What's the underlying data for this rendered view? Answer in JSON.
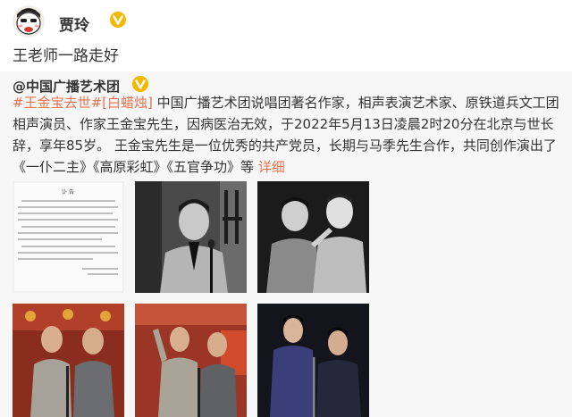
{
  "header": {
    "username": "贾玲",
    "avatar_icon": "cartoon-face-avatar-icon",
    "verified_icon": "verified-v-icon"
  },
  "post": {
    "text": "王老师一路走好"
  },
  "repost": {
    "author": "@中国广播艺术团",
    "verified_icon": "verified-v-icon",
    "hashtag": "#王金宝去世#",
    "tag": "[白蜡烛]",
    "body_text": " 中国广播艺术团说唱团著名作家，相声表演艺术家、原铁道兵文工团相声演员、作家王金宝先生，因病医治无效，于2022年5月13日凌晨2时20分在北京与世长辞，享年85岁。 王金宝先生是一位优秀的共产党员，长期与马季先生合作，共同创作演出了《一仆二主》《高原彩虹》《五官争功》等 ",
    "more_label": "详细"
  },
  "images": [
    {
      "kind": "document",
      "label": "讣 告"
    },
    {
      "kind": "portrait-bw"
    },
    {
      "kind": "duo-bw"
    },
    {
      "kind": "stage-duo-color"
    },
    {
      "kind": "stage-duo-color-2"
    },
    {
      "kind": "stage-duo-dark"
    }
  ],
  "colors": {
    "link": "#eb7350",
    "verified": "#f5b800",
    "repost_bg": "#f7f7f7"
  }
}
